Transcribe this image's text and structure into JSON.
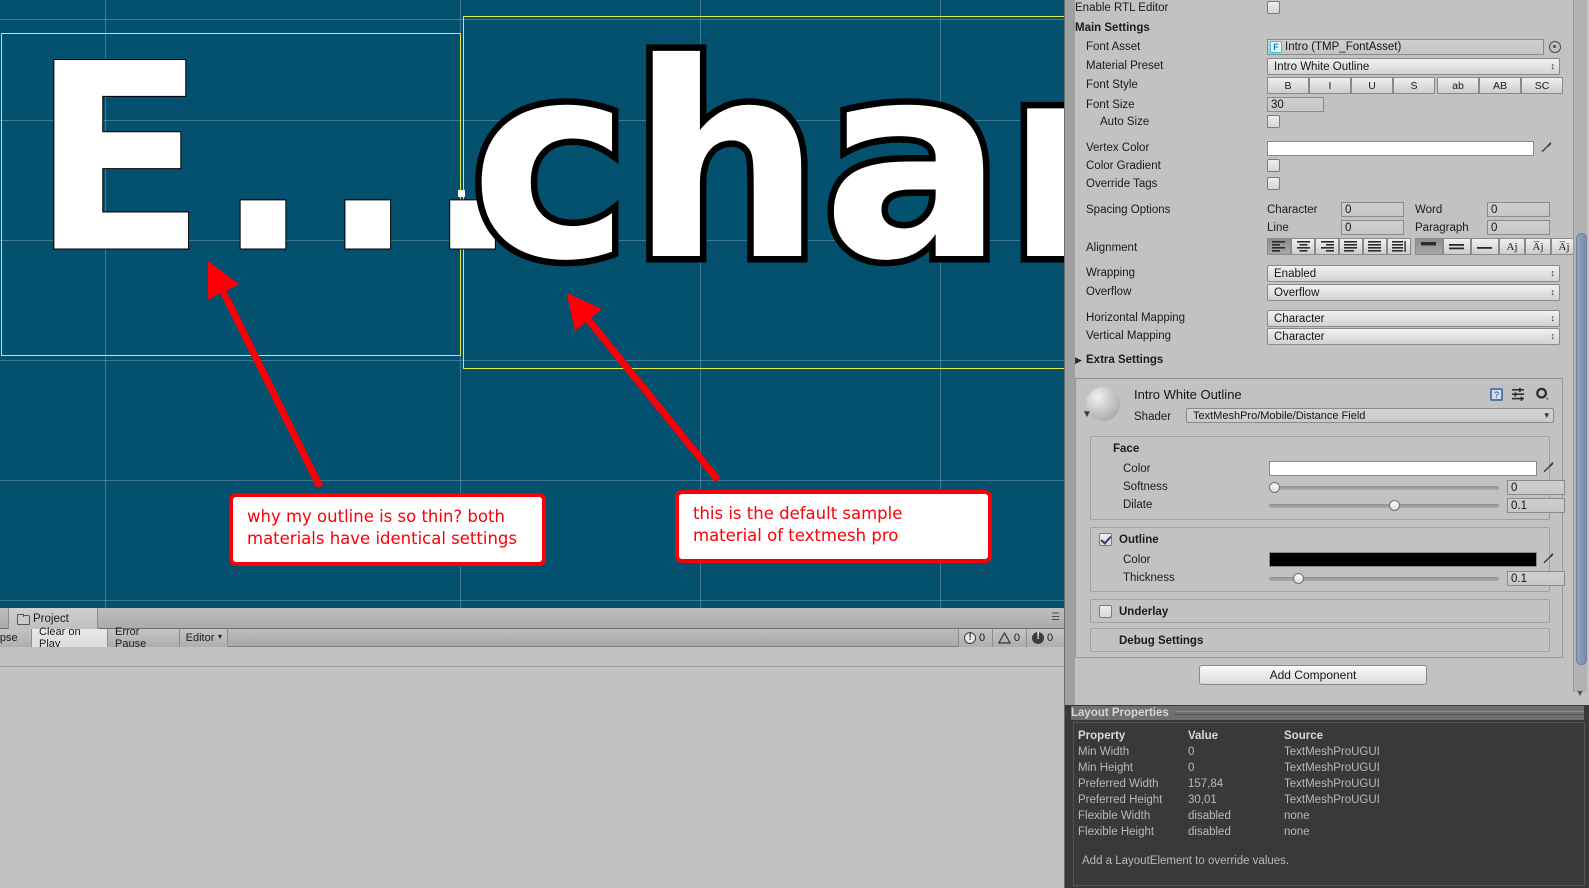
{
  "scene": {
    "background_color": "#03506f",
    "thin_text": "E...",
    "thick_text": "char",
    "selection_color": "#e8e83c",
    "annotations": [
      {
        "id": "callout-1",
        "text": "why my outline is so thin? both materials have identical settings"
      },
      {
        "id": "callout-2",
        "text": "this is the default sample material of textmesh pro"
      }
    ],
    "annotation_color": "#fb0007"
  },
  "project_panel": {
    "tab_label": "Project",
    "folder_icon": "folder-icon",
    "menu_icon": "panel-menu-icon"
  },
  "console_toolbar": {
    "collapse_label": "lapse",
    "clear_on_play_label": "Clear on Play",
    "error_pause_label": "Error Pause",
    "editor_label": "Editor",
    "counts": {
      "errors": "0",
      "warnings": "0",
      "infos": "0"
    }
  },
  "inspector": {
    "enable_rtl_editor": {
      "label": "Enable RTL Editor",
      "checked": false
    },
    "main_settings_header": "Main Settings",
    "font_asset": {
      "label": "Font Asset",
      "value": "Intro (TMP_FontAsset)",
      "badge": "F",
      "picker_icon": "object-picker-icon"
    },
    "material_preset": {
      "label": "Material Preset",
      "value": "Intro White Outline"
    },
    "font_style": {
      "label": "Font Style",
      "buttons": [
        "B",
        "I",
        "U",
        "S",
        "ab",
        "AB",
        "SC"
      ]
    },
    "font_size": {
      "label": "Font Size",
      "value": "30"
    },
    "auto_size": {
      "label": "Auto Size",
      "checked": false
    },
    "vertex_color": {
      "label": "Vertex Color",
      "value": "#ffffff",
      "eyedropper_icon": "eyedropper-icon"
    },
    "color_gradient": {
      "label": "Color Gradient",
      "checked": false
    },
    "override_tags": {
      "label": "Override Tags",
      "checked": false
    },
    "spacing_options": {
      "label": "Spacing Options",
      "character_label": "Character",
      "character_value": "0",
      "word_label": "Word",
      "word_value": "0",
      "line_label": "Line",
      "line_value": "0",
      "paragraph_label": "Paragraph",
      "paragraph_value": "0"
    },
    "alignment": {
      "label": "Alignment",
      "horizontal_icons": [
        "align-left-icon",
        "align-center-icon",
        "align-right-icon",
        "align-justify-icon",
        "align-flush-icon",
        "align-geometry-icon"
      ],
      "horizontal_selected": 0,
      "vertical_icons": [
        "valign-top-icon",
        "valign-middle-icon",
        "valign-bottom-icon",
        "valign-baseline-icon",
        "valign-midline-icon",
        "valign-capline-icon"
      ],
      "vertical_selected": 0
    },
    "wrapping": {
      "label": "Wrapping",
      "value": "Enabled"
    },
    "overflow": {
      "label": "Overflow",
      "value": "Overflow"
    },
    "horizontal_mapping": {
      "label": "Horizontal Mapping",
      "value": "Character"
    },
    "vertical_mapping": {
      "label": "Vertical Mapping",
      "value": "Character"
    },
    "extra_settings": {
      "label": "Extra Settings",
      "expanded": false,
      "foldout_icon": "triangle-right-icon"
    },
    "material": {
      "name": "Intro White Outline",
      "preview_icon": "material-sphere-icon",
      "foldout_icon": "triangle-down-icon",
      "help_icon": "help-book-icon",
      "preset_icon": "preset-icon",
      "gear_icon": "gear-icon",
      "shader_label": "Shader",
      "shader_value": "TextMeshPro/Mobile/Distance Field",
      "face": {
        "header": "Face",
        "color_label": "Color",
        "color_value": "#ffffff",
        "softness_label": "Softness",
        "softness_value": "0",
        "softness_fraction": 0.0,
        "dilate_label": "Dilate",
        "dilate_value": "0.1",
        "dilate_fraction": 0.55
      },
      "outline": {
        "header": "Outline",
        "checked": true,
        "color_label": "Color",
        "color_value": "#000000",
        "thickness_label": "Thickness",
        "thickness_value": "0.1",
        "thickness_fraction": 0.11
      },
      "underlay": {
        "header": "Underlay",
        "checked": false
      },
      "debug_settings": {
        "header": "Debug Settings"
      }
    },
    "add_component_label": "Add Component"
  },
  "layout_properties": {
    "title": "Layout Properties",
    "columns": [
      "Property",
      "Value",
      "Source"
    ],
    "rows": [
      {
        "property": "Min Width",
        "value": "0",
        "source": "TextMeshProUGUI"
      },
      {
        "property": "Min Height",
        "value": "0",
        "source": "TextMeshProUGUI"
      },
      {
        "property": "Preferred Width",
        "value": "157,84",
        "source": "TextMeshProUGUI"
      },
      {
        "property": "Preferred Height",
        "value": "30,01",
        "source": "TextMeshProUGUI"
      },
      {
        "property": "Flexible Width",
        "value": "disabled",
        "source": "none"
      },
      {
        "property": "Flexible Height",
        "value": "disabled",
        "source": "none"
      }
    ],
    "note": "Add a LayoutElement to override values."
  }
}
